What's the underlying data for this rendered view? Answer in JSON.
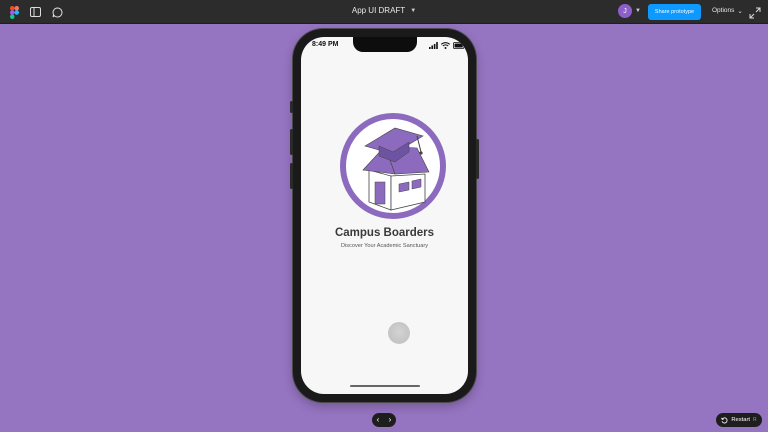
{
  "toolbar": {
    "file_title": "App UI DRAFT",
    "avatar_initial": "J",
    "share_label": "Share prototype",
    "options_label": "Options",
    "icons": [
      "figma-logo-icon",
      "sidebar-toggle-icon",
      "comment-icon",
      "chevron-down-icon",
      "expand-icon"
    ]
  },
  "phone": {
    "status_time": "8:49 PM",
    "app_name": "Campus Boarders",
    "tagline": "Discover Your Academic Sanctuary"
  },
  "controls": {
    "prev_label": "‹",
    "next_label": "›",
    "restart_label": "Restart",
    "restart_key": "R"
  },
  "colors": {
    "canvas": "#9574c1",
    "accent": "#0d99ff",
    "brand": "#8c6bbf"
  }
}
